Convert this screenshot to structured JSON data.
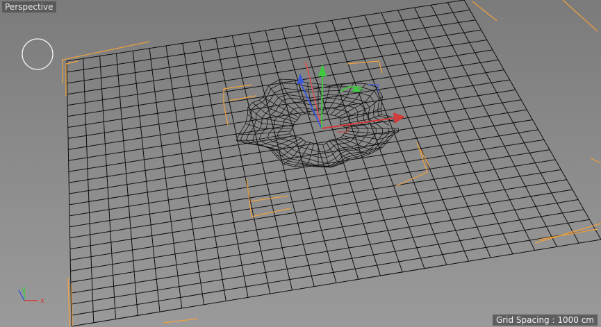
{
  "viewport": {
    "view_name": "Perspective",
    "grid_spacing_text": "Grid Spacing : 1000 cm"
  },
  "axis_indicator": {
    "y_label": "y",
    "x_label": "x"
  },
  "colors": {
    "background": "#8a8a8a",
    "grid_line": "#0d0d0d",
    "selection_bracket": "#f2a13a",
    "axis_x": "#d33a3a",
    "axis_y": "#3ec93e",
    "axis_z": "#3a56d8"
  },
  "icons": {
    "navigation": "navigation-circle-icon",
    "move_gizmo": "move-gizmo-icon",
    "axis_indicator": "world-axis-icon"
  }
}
